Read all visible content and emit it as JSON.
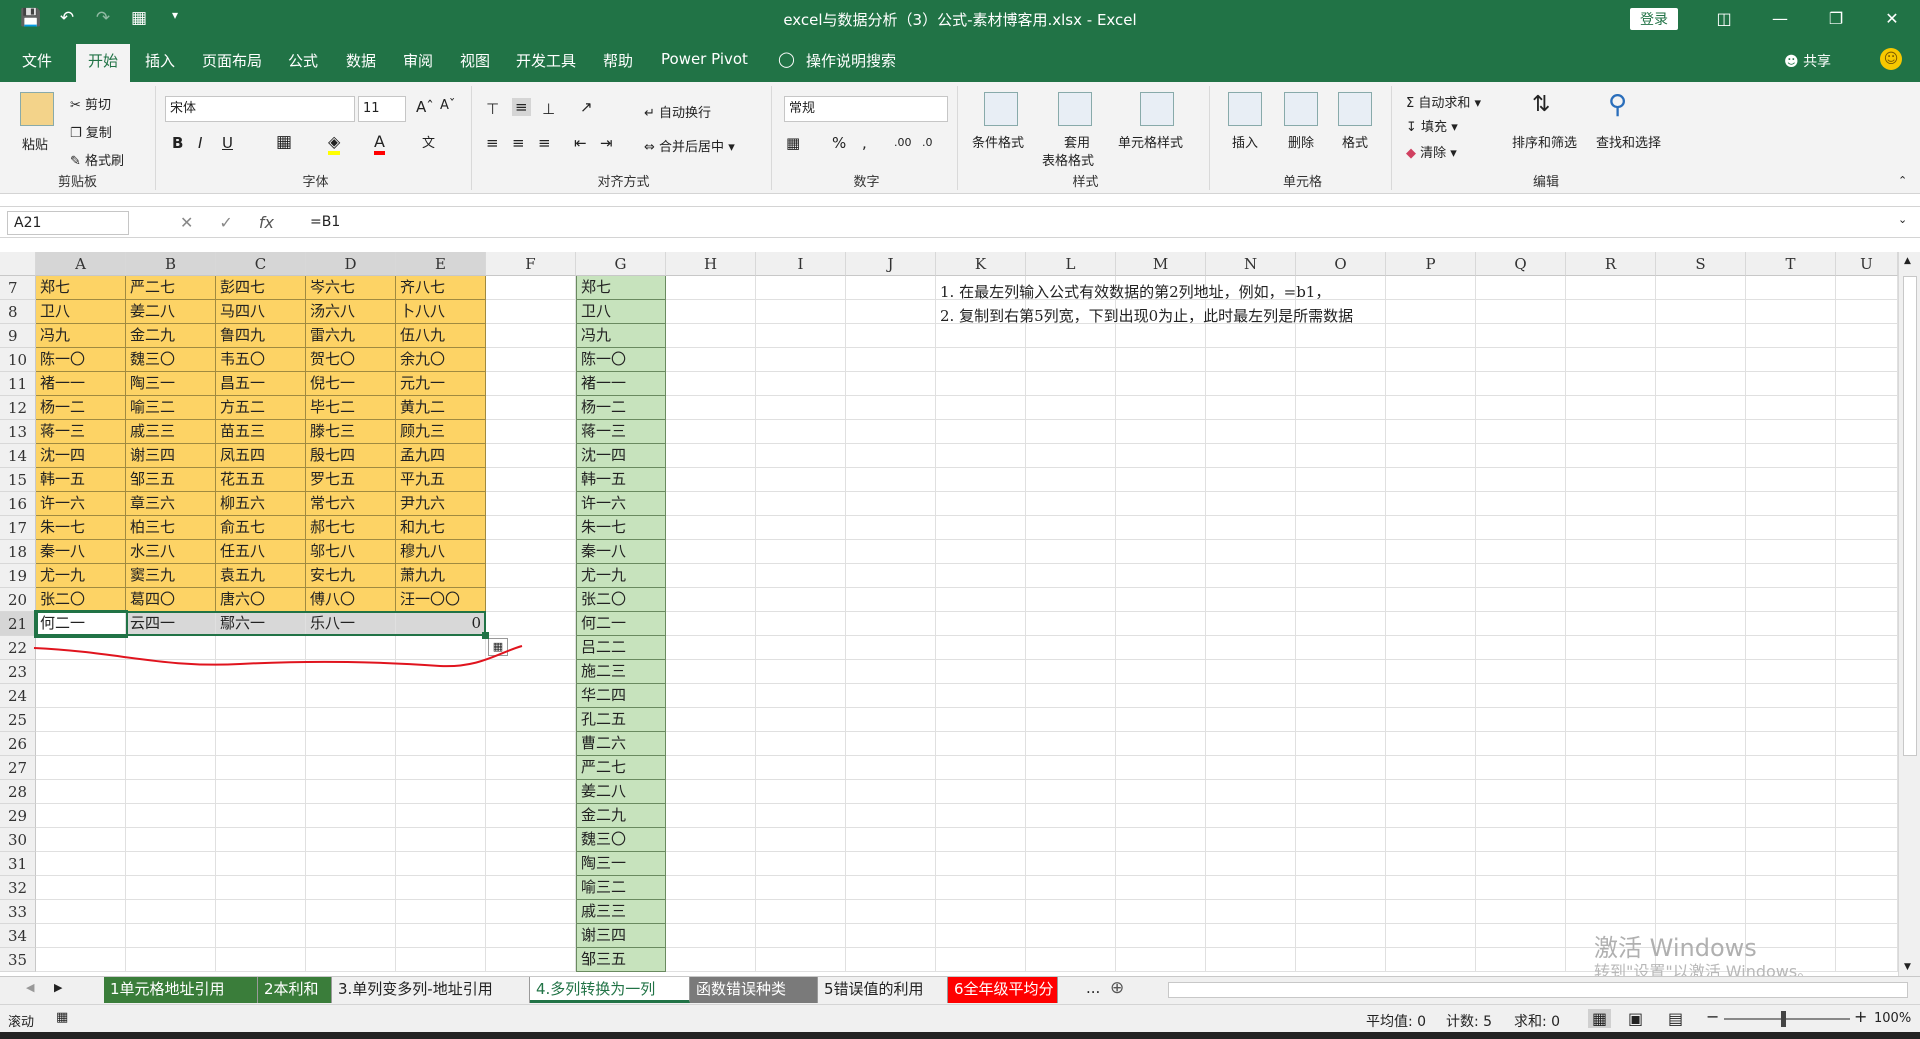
{
  "titlebar": {
    "title": "excel与数据分析（3）公式-素材博客用.xlsx - Excel",
    "login": "登录"
  },
  "menu": {
    "tabs": [
      "文件",
      "开始",
      "插入",
      "页面布局",
      "公式",
      "数据",
      "审阅",
      "视图",
      "开发工具",
      "帮助",
      "Power Pivot",
      "操作说明搜索"
    ],
    "share": "共享"
  },
  "ribbon": {
    "clipboard": {
      "paste": "粘贴",
      "cut": "剪切",
      "copy": "复制",
      "format_painter": "格式刷",
      "label": "剪贴板"
    },
    "font": {
      "name": "宋体",
      "size": "11",
      "bold": "B",
      "italic": "I",
      "underline": "U",
      "label": "字体"
    },
    "align": {
      "wrap": "自动换行",
      "merge": "合并后居中",
      "label": "对齐方式"
    },
    "number": {
      "format": "常规",
      "percent": "%",
      "comma": ",",
      "label": "数字"
    },
    "styles": {
      "cond": "条件格式",
      "table1": "套用",
      "table2": "表格格式",
      "cell_style": "单元格样式",
      "label": "样式"
    },
    "cells": {
      "insert": "插入",
      "delete": "删除",
      "format": "格式",
      "label": "单元格"
    },
    "editing": {
      "autosum": "自动求和",
      "fill": "填充",
      "clear": "清除",
      "sort": "排序和筛选",
      "find": "查找和选择",
      "label": "编辑"
    }
  },
  "formula_bar": {
    "name_box": "A21",
    "formula": "=B1",
    "fx": "fx"
  },
  "columns": [
    "A",
    "B",
    "C",
    "D",
    "E",
    "F",
    "G",
    "H",
    "I",
    "J",
    "K",
    "L",
    "M",
    "N",
    "O",
    "P",
    "Q",
    "R",
    "S",
    "T",
    "U"
  ],
  "rows": [
    "7",
    "8",
    "9",
    "10",
    "11",
    "12",
    "13",
    "14",
    "15",
    "16",
    "17",
    "18",
    "19",
    "20",
    "21",
    "22",
    "23",
    "24",
    "25",
    "26",
    "27",
    "28",
    "29",
    "30",
    "31",
    "32",
    "33",
    "34",
    "35"
  ],
  "table_AE": [
    [
      "郑七",
      "严二七",
      "彭四七",
      "岑六七",
      "齐八七"
    ],
    [
      "卫八",
      "姜二八",
      "马四八",
      "汤六八",
      "卜八八"
    ],
    [
      "冯九",
      "金二九",
      "鲁四九",
      "雷六九",
      "伍八九"
    ],
    [
      "陈一〇",
      "魏三〇",
      "韦五〇",
      "贺七〇",
      "余九〇"
    ],
    [
      "褚一一",
      "陶三一",
      "昌五一",
      "倪七一",
      "元九一"
    ],
    [
      "杨一二",
      "喻三二",
      "方五二",
      "毕七二",
      "黄九二"
    ],
    [
      "蒋一三",
      "戚三三",
      "苗五三",
      "滕七三",
      "顾九三"
    ],
    [
      "沈一四",
      "谢三四",
      "凤五四",
      "殷七四",
      "孟九四"
    ],
    [
      "韩一五",
      "邹三五",
      "花五五",
      "罗七五",
      "平九五"
    ],
    [
      "许一六",
      "章三六",
      "柳五六",
      "常七六",
      "尹九六"
    ],
    [
      "朱一七",
      "柏三七",
      "俞五七",
      "郝七七",
      "和九七"
    ],
    [
      "秦一八",
      "水三八",
      "任五八",
      "邬七八",
      "穆九八"
    ],
    [
      "尤一九",
      "窦三九",
      "袁五九",
      "安七九",
      "萧九九"
    ],
    [
      "张二〇",
      "葛四〇",
      "唐六〇",
      "傅八〇",
      "汪一〇〇"
    ],
    [
      "何二一",
      "云四一",
      "鄢六一",
      "乐八一",
      "0"
    ]
  ],
  "col_G": [
    "郑七",
    "卫八",
    "冯九",
    "陈一〇",
    "褚一一",
    "杨一二",
    "蒋一三",
    "沈一四",
    "韩一五",
    "许一六",
    "朱一七",
    "秦一八",
    "尤一九",
    "张二〇",
    "何二一",
    "吕二二",
    "施二三",
    "华二四",
    "孔二五",
    "曹二六",
    "严二七",
    "姜二八",
    "金二九",
    "魏三〇",
    "陶三一",
    "喻三二",
    "戚三三",
    "谢三四",
    "邹三五"
  ],
  "notes": [
    "1. 在最左列输入公式有效数据的第2列地址，例如，=b1，",
    "2. 复制到右第5列宽，下到出现0为止，此时最左列是所需数据"
  ],
  "sheet_tabs": [
    {
      "label": "1单元格地址引用",
      "bg": "#3a7d3a",
      "fg": "#ffffff"
    },
    {
      "label": "2本利和",
      "bg": "#3a7d3a",
      "fg": "#ffffff"
    },
    {
      "label": "3.单列变多列-地址引用",
      "bg": "#f0f0f0",
      "fg": "#222222"
    },
    {
      "label": "4.多列转换为一列",
      "bg": "#ffffff",
      "fg": "#217346"
    },
    {
      "label": "函数错误种类",
      "bg": "#7a7a7a",
      "fg": "#ffffff"
    },
    {
      "label": "5错误值的利用",
      "bg": "#f0f0f0",
      "fg": "#222222"
    },
    {
      "label": "6全年级平均分",
      "bg": "#ff0000",
      "fg": "#ffffff"
    }
  ],
  "sheet_more": "...",
  "status": {
    "mode": "滚动",
    "average": "平均值: 0",
    "count": "计数: 5",
    "sum": "求和: 0",
    "zoom": "100%"
  },
  "watermark": {
    "line1": "激活 Windows",
    "line2": "转到\"设置\"以激活 Windows。"
  }
}
